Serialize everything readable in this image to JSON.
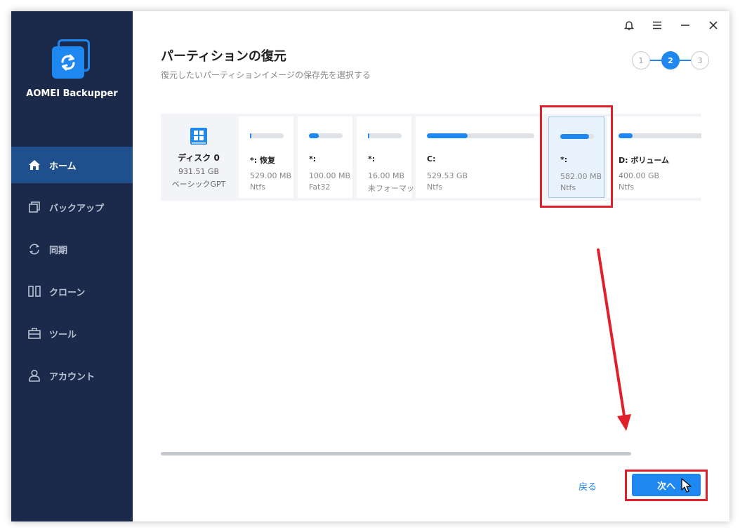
{
  "app": {
    "name": "AOMEI Backupper"
  },
  "colors": {
    "accent": "#1e87f0",
    "sidebar_bg": "#1b2a4a",
    "sidebar_active": "#1f4f8c",
    "highlight": "#e0202a"
  },
  "titlebar": {
    "icons": [
      "bell-icon",
      "menu-icon",
      "minimize-icon",
      "close-icon"
    ]
  },
  "sidebar": {
    "items": [
      {
        "label": "ホーム",
        "icon": "home-icon",
        "active": true
      },
      {
        "label": "バックアップ",
        "icon": "backup-icon",
        "active": false
      },
      {
        "label": "同期",
        "icon": "sync-icon",
        "active": false
      },
      {
        "label": "クローン",
        "icon": "clone-icon",
        "active": false
      },
      {
        "label": "ツール",
        "icon": "tools-icon",
        "active": false
      },
      {
        "label": "アカウント",
        "icon": "account-icon",
        "active": false
      }
    ]
  },
  "header": {
    "title": "パーティションの復元",
    "subtitle": "復元したいパーティションイメージの保存先を選択する"
  },
  "steps": {
    "items": [
      "1",
      "2",
      "3"
    ],
    "current": 2
  },
  "disk": {
    "name": "ディスク 0",
    "size": "931.51 GB",
    "type": "ベーシックGPT",
    "partitions": [
      {
        "label": "*: 恢复",
        "size": "529.00 MB",
        "fs": "Ntfs",
        "used": 0.05,
        "selected": false
      },
      {
        "label": "*:",
        "size": "100.00 MB",
        "fs": "Fat32",
        "used": 0.3,
        "selected": false
      },
      {
        "label": "*:",
        "size": "16.00 MB",
        "fs": "未フォーマット",
        "used": 0.04,
        "selected": false
      },
      {
        "label": "C:",
        "size": "529.53 GB",
        "fs": "Ntfs",
        "used": 0.38,
        "selected": false
      },
      {
        "label": "*:",
        "size": "582.00 MB",
        "fs": "Ntfs",
        "used": 0.85,
        "selected": true
      },
      {
        "label": "D: ボリューム",
        "size": "400.00 GB",
        "fs": "Ntfs",
        "used": 0.15,
        "selected": false
      }
    ]
  },
  "footer": {
    "back_label": "戻る",
    "next_label": "次へ"
  }
}
